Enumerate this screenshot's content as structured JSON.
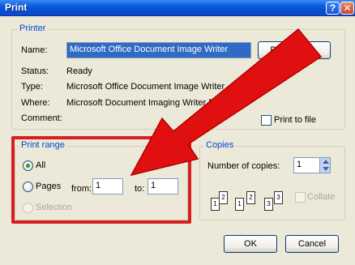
{
  "window": {
    "title": "Print",
    "help_glyph": "?",
    "close_glyph": "✕"
  },
  "printer": {
    "group_label": "Printer",
    "name_label": "Name:",
    "name_value": "Microsoft Office Document Image Writer",
    "properties_label": "Properties...",
    "status_label": "Status:",
    "status_value": "Ready",
    "type_label": "Type:",
    "type_value": "Microsoft Office Document Image Writer",
    "where_label": "Where:",
    "where_value": "Microsoft Document Imaging Writer Port:",
    "comment_label": "Comment:",
    "print_to_file_label": "Print to file"
  },
  "print_range": {
    "group_label": "Print range",
    "all_label": "All",
    "pages_label": "Pages",
    "from_label": "from:",
    "from_value": "1",
    "to_label": "to:",
    "to_value": "1",
    "selection_label": "Selection",
    "selected": "All"
  },
  "copies": {
    "group_label": "Copies",
    "number_label": "Number of copies:",
    "number_value": "1",
    "collate_label": "Collate",
    "page_numbers": [
      "1",
      "2",
      "1",
      "2",
      "3",
      "3"
    ]
  },
  "buttons": {
    "ok": "OK",
    "cancel": "Cancel"
  },
  "overlay": {
    "highlight_color": "#d81e1e",
    "arrow_color": "#e01010"
  }
}
